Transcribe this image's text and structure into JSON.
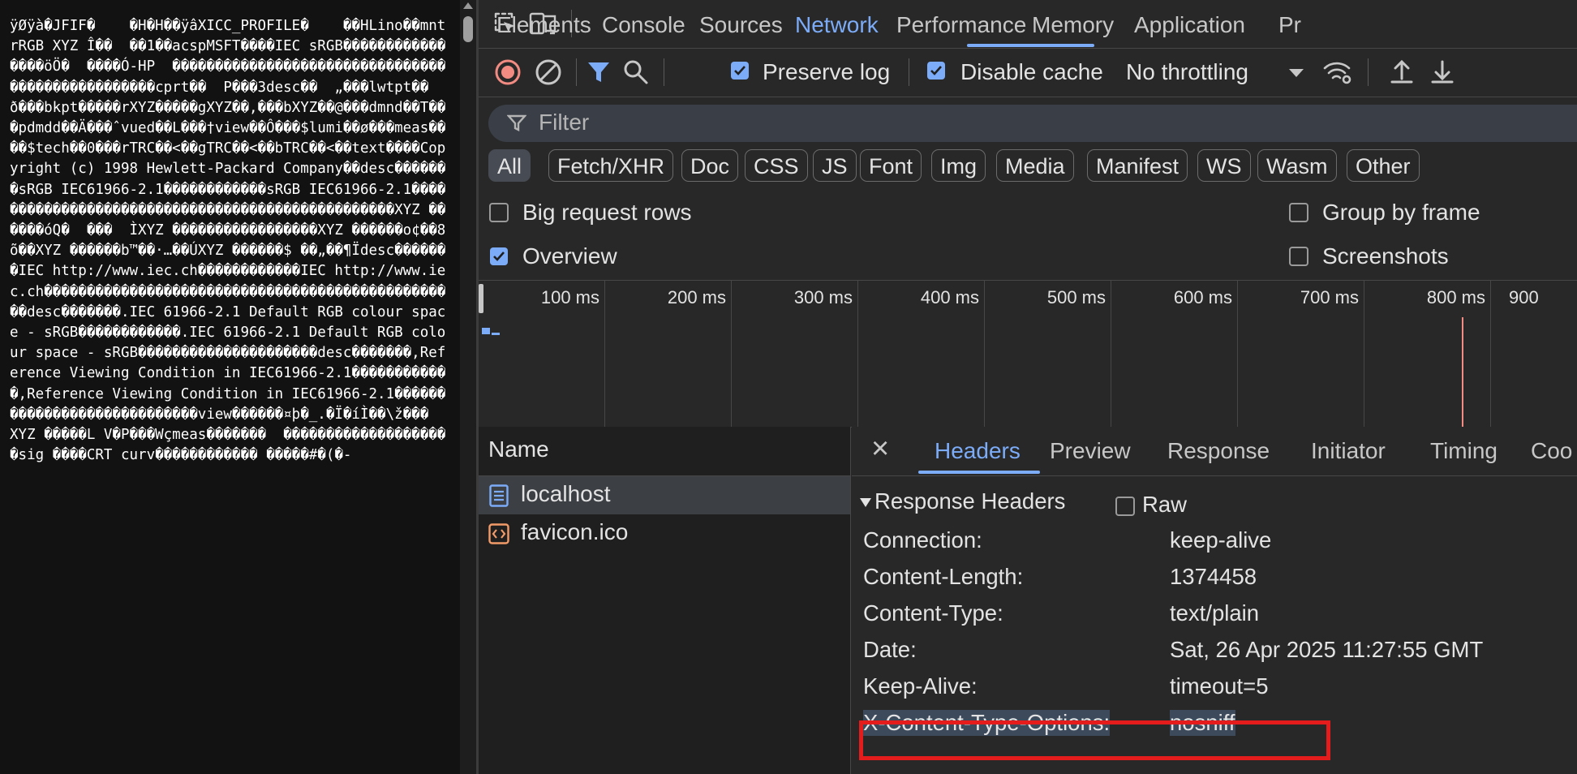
{
  "raw_page": {
    "text": "ÿØÿà�JFIF�    �H�H��ÿâXICC_PROFILE�    ��HLino��mntrRGB XYZ Î��  ��1��acspMSFT����IEC sRGB����������������öÖ�  ����Ó-HP  �������������������������������������������������cprt��  P���3desc��  „���lwtpt��  ð���bkpt�����rXYZ�����gXYZ��,���bXYZ��@���dmnd��T���pdmdd��Ä���ˆvued��L���†view��Ô���$lumi��ø���meas����$tech��0���rTRC��<��gTRC��<��bTRC��<��text����Copyright (c) 1998 Hewlett-Packard Company��desc�������sRGB IEC61966-2.1������������sRGB IEC61966-2.1�������������������������������������������������XYZ ������óQ�  ���  ÌXYZ �����������������XYZ ������o¢��8õ��XYZ ������b™��·…��ÚXYZ ������$ ��„��¶Ïdesc�������IEC http://www.iec.ch������������IEC http://www.iec.ch�������������������������������������������������desc�������.IEC 61966-2.1 Default RGB colour space - sRGB������������.IEC 61966-2.1 Default RGB colour space - sRGB���������������������desc�������,Reference Viewing Condition in IEC61966-2.1������������,Reference Viewing Condition in IEC61966-2.1����������������������������view������¤þ�_.�Ï�íÌ��\\ž���  XYZ �����L V�P���Wçmeas�������  ��������������������sig ����CRT curv������������ �����#�(�-"
  },
  "colors": {
    "accent": "#7cacf8",
    "record_red": "#f28b82",
    "highlight_red": "#e41c1c",
    "doc_icon_blue": "#7cacf8",
    "favicon_orange": "#f29b68"
  },
  "devtools": {
    "tabs": [
      "Elements",
      "Console",
      "Sources",
      "Network",
      "Performance",
      "Memory",
      "Application",
      "Pr"
    ],
    "active_tab": "Network",
    "toolbar": {
      "preserve_log": "Preserve log",
      "preserve_log_checked": true,
      "disable_cache": "Disable cache",
      "disable_cache_checked": true,
      "throttling": "No throttling",
      "icons": [
        "inspect-icon",
        "device-toolbar-icon",
        "record-stop-icon",
        "clear-icon",
        "filter-icon",
        "search-icon",
        "network-conditions-icon",
        "import-har-icon",
        "export-har-icon"
      ]
    },
    "filter": {
      "placeholder": "Filter",
      "types": [
        "All",
        "Fetch/XHR",
        "Doc",
        "CSS",
        "JS",
        "Font",
        "Img",
        "Media",
        "Manifest",
        "WS",
        "Wasm",
        "Other"
      ],
      "active_type": "All"
    },
    "options": {
      "big_request_rows": "Big request rows",
      "big_request_rows_checked": false,
      "group_by_frame": "Group by frame",
      "group_by_frame_checked": false,
      "overview": "Overview",
      "overview_checked": true,
      "screenshots": "Screenshots",
      "screenshots_checked": false
    },
    "overview": {
      "ticks": [
        "100 ms",
        "200 ms",
        "300 ms",
        "400 ms",
        "500 ms",
        "600 ms",
        "700 ms",
        "800 ms",
        "900"
      ]
    },
    "requests": {
      "column_header": "Name",
      "rows": [
        {
          "name": "localhost",
          "icon": "document-icon",
          "selected": true
        },
        {
          "name": "favicon.ico",
          "icon": "script-icon",
          "selected": false
        }
      ]
    },
    "details": {
      "close_label": "×",
      "tabs": [
        "Headers",
        "Preview",
        "Response",
        "Initiator",
        "Timing",
        "Coo"
      ],
      "active_tab": "Headers",
      "section_title": "Response Headers",
      "raw_label": "Raw",
      "raw_checked": false,
      "headers": [
        {
          "name": "Connection:",
          "value": "keep-alive"
        },
        {
          "name": "Content-Length:",
          "value": "1374458"
        },
        {
          "name": "Content-Type:",
          "value": "text/plain"
        },
        {
          "name": "Date:",
          "value": "Sat, 26 Apr 2025 11:27:55 GMT"
        },
        {
          "name": "Keep-Alive:",
          "value": "timeout=5"
        },
        {
          "name": "X-Content-Type-Options:",
          "value": "nosniff"
        }
      ],
      "highlighted_header": "X-Content-Type-Options:"
    }
  }
}
